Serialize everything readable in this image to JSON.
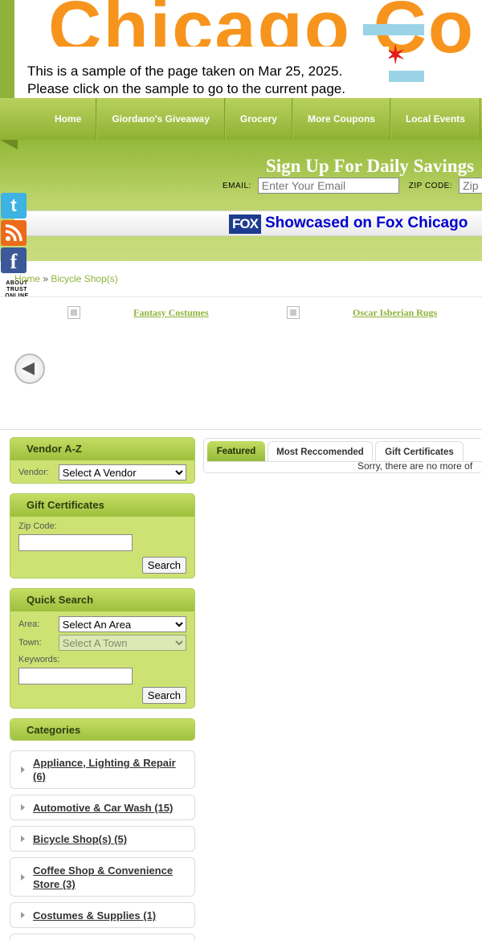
{
  "header": {
    "logo_text": "Chicago Co",
    "sample_notice_line1": "This is a sample of the page taken on Mar 25, 2025.",
    "sample_notice_line2": "Please click on the sample to go to the current page."
  },
  "nav": {
    "items": [
      "Home",
      "Giordano's Giveaway",
      "Grocery",
      "More Coupons",
      "Local Events"
    ]
  },
  "signup": {
    "title": "Sign Up For Daily Savings",
    "email_label": "EMAIL:",
    "email_placeholder": "Enter Your Email",
    "zip_label": "ZIP CODE:",
    "zip_placeholder": "Zip"
  },
  "fox": {
    "logo": "FOX",
    "text": "Showcased on Fox Chicago"
  },
  "social": {
    "twitter": "t",
    "facebook": "f",
    "trust_line1": "ABOUT",
    "trust_line2": "TRUST",
    "trust_line3": "ONLINE"
  },
  "breadcrumb": {
    "home": "Home",
    "separator": "»",
    "current": "Bicycle Shop(s)"
  },
  "ads": [
    {
      "label": "Fantasy Costumes"
    },
    {
      "label": "Oscar Isberian Rugs"
    }
  ],
  "sidebar": {
    "vendor": {
      "title": "Vendor A-Z",
      "label": "Vendor:",
      "selected": "Select A Vendor"
    },
    "gift": {
      "title": "Gift Certificates",
      "zip_label": "Zip Code:",
      "search_label": "Search"
    },
    "quick": {
      "title": "Quick Search",
      "area_label": "Area:",
      "area_selected": "Select An Area",
      "town_label": "Town:",
      "town_selected": "Select A Town",
      "keywords_label": "Keywords:",
      "search_label": "Search"
    },
    "categories_title": "Categories",
    "categories": [
      {
        "label": "Appliance, Lighting & Repair (6)"
      },
      {
        "label": "Automotive & Car Wash (15)"
      },
      {
        "label": "Bicycle Shop(s) (5)"
      },
      {
        "label": "Coffee Shop & Convenience Store (3)"
      },
      {
        "label": "Costumes & Supplies (1)"
      }
    ]
  },
  "tabs": {
    "items": [
      "Featured",
      "Most Reccomended",
      "Gift Certificates"
    ],
    "active": "Featured",
    "empty_message": "Sorry, there are no more of"
  },
  "colors": {
    "brand_green": "#8fb23a",
    "brand_orange": "#f7941d",
    "fox_blue": "#0000cc"
  }
}
